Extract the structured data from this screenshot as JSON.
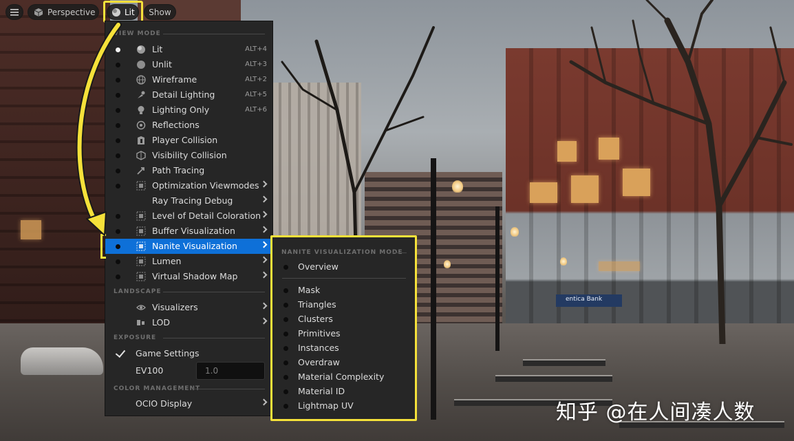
{
  "toolbar": {
    "menu_icon": "hamburger-icon",
    "perspective_label": "Perspective",
    "lit_label": "Lit",
    "show_label": "Show"
  },
  "view_mode": {
    "section": "VIEW MODE",
    "items": [
      {
        "label": "Lit",
        "shortcut": "ALT+4",
        "selected": true,
        "icon": "lit-sphere-icon"
      },
      {
        "label": "Unlit",
        "shortcut": "ALT+3",
        "icon": "unlit-sphere-icon"
      },
      {
        "label": "Wireframe",
        "shortcut": "ALT+2",
        "icon": "wireframe-globe-icon"
      },
      {
        "label": "Detail Lighting",
        "shortcut": "ALT+5",
        "icon": "detail-lighting-icon"
      },
      {
        "label": "Lighting Only",
        "shortcut": "ALT+6",
        "icon": "lightbulb-icon"
      },
      {
        "label": "Reflections",
        "icon": "reflection-icon"
      },
      {
        "label": "Player Collision",
        "icon": "player-collision-icon"
      },
      {
        "label": "Visibility Collision",
        "icon": "visibility-collision-icon"
      },
      {
        "label": "Path Tracing",
        "icon": "path-tracing-icon"
      },
      {
        "label": "Optimization Viewmodes",
        "submenu": true,
        "icon": "grid-icon"
      },
      {
        "label": "Ray Tracing Debug",
        "submenu": true
      },
      {
        "label": "Level of Detail Coloration",
        "submenu": true,
        "icon": "grid-icon"
      },
      {
        "label": "Buffer Visualization",
        "submenu": true,
        "icon": "grid-icon"
      },
      {
        "label": "Nanite Visualization",
        "submenu": true,
        "active": true,
        "icon": "grid-icon"
      },
      {
        "label": "Lumen",
        "submenu": true,
        "icon": "grid-icon"
      },
      {
        "label": "Virtual Shadow Map",
        "submenu": true,
        "icon": "grid-icon"
      }
    ]
  },
  "landscape": {
    "section": "LANDSCAPE",
    "items": [
      {
        "label": "Visualizers",
        "submenu": true,
        "icon": "eye-icon"
      },
      {
        "label": "LOD",
        "submenu": true,
        "icon": "lod-icon"
      }
    ]
  },
  "exposure": {
    "section": "EXPOSURE",
    "game_settings": "Game Settings",
    "ev100_label": "EV100",
    "ev100_value": "1.0"
  },
  "color_management": {
    "section": "COLOR MANAGEMENT",
    "ocio_display": "OCIO Display"
  },
  "nanite_submenu": {
    "section": "NANITE VISUALIZATION MODE",
    "overview": "Overview",
    "items": [
      "Mask",
      "Triangles",
      "Clusters",
      "Primitives",
      "Instances",
      "Overdraw",
      "Material Complexity",
      "Material ID",
      "Lightmap UV"
    ]
  },
  "scene": {
    "bank_sign": "entica Bank",
    "watermark": "知乎 @在人间凑人数"
  },
  "colors": {
    "highlight": "#f5e13a",
    "active": "#0e70d8"
  }
}
